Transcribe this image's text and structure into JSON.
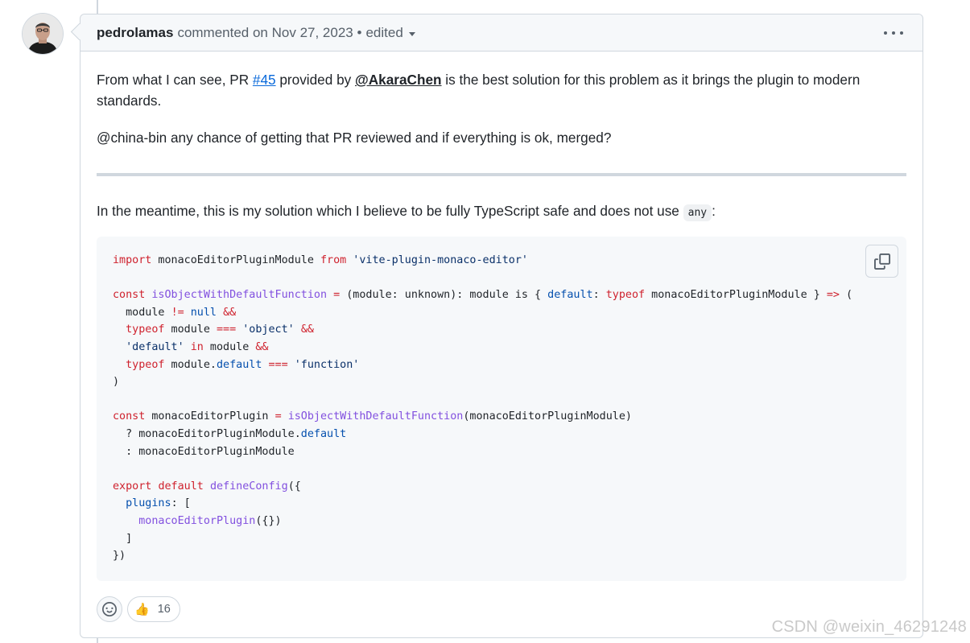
{
  "comment": {
    "author": "pedrolamas",
    "action": "commented on",
    "date": "Nov 27, 2023",
    "bullet": "•",
    "edited_label": "edited",
    "body": {
      "p1_pre": "From what I can see, PR ",
      "p1_link": "#45",
      "p1_mid": " provided by ",
      "p1_mention": "@AkaraChen",
      "p1_post": " is the best solution for this problem as it brings the plugin to modern standards.",
      "p2": "@china-bin any chance of getting that PR reviewed and if everything is ok, merged?",
      "p3_pre": "In the meantime, this is my solution which I believe to be fully TypeScript safe and does not use ",
      "p3_code": "any",
      "p3_post": ":"
    },
    "code_lines": [
      [
        {
          "t": "import",
          "c": "kw"
        },
        {
          "t": " monacoEditorPluginModule "
        },
        {
          "t": "from",
          "c": "kw"
        },
        {
          "t": " "
        },
        {
          "t": "'vite-plugin-monaco-editor'",
          "c": "st"
        }
      ],
      [],
      [
        {
          "t": "const",
          "c": "kw"
        },
        {
          "t": " "
        },
        {
          "t": "isObjectWithDefaultFunction",
          "c": "fn"
        },
        {
          "t": " "
        },
        {
          "t": "=",
          "c": "kw"
        },
        {
          "t": " (module: unknown): module is { "
        },
        {
          "t": "default",
          "c": "cn"
        },
        {
          "t": ": "
        },
        {
          "t": "typeof",
          "c": "kw"
        },
        {
          "t": " monacoEditorPluginModule } "
        },
        {
          "t": "=>",
          "c": "kw"
        },
        {
          "t": " ("
        }
      ],
      [
        {
          "t": "  module "
        },
        {
          "t": "!=",
          "c": "kw"
        },
        {
          "t": " "
        },
        {
          "t": "null",
          "c": "cn"
        },
        {
          "t": " "
        },
        {
          "t": "&&",
          "c": "kw"
        }
      ],
      [
        {
          "t": "  "
        },
        {
          "t": "typeof",
          "c": "kw"
        },
        {
          "t": " module "
        },
        {
          "t": "===",
          "c": "kw"
        },
        {
          "t": " "
        },
        {
          "t": "'object'",
          "c": "st"
        },
        {
          "t": " "
        },
        {
          "t": "&&",
          "c": "kw"
        }
      ],
      [
        {
          "t": "  "
        },
        {
          "t": "'default'",
          "c": "st"
        },
        {
          "t": " "
        },
        {
          "t": "in",
          "c": "kw"
        },
        {
          "t": " module "
        },
        {
          "t": "&&",
          "c": "kw"
        }
      ],
      [
        {
          "t": "  "
        },
        {
          "t": "typeof",
          "c": "kw"
        },
        {
          "t": " module."
        },
        {
          "t": "default",
          "c": "cn"
        },
        {
          "t": " "
        },
        {
          "t": "===",
          "c": "kw"
        },
        {
          "t": " "
        },
        {
          "t": "'function'",
          "c": "st"
        }
      ],
      [
        {
          "t": ")"
        }
      ],
      [],
      [
        {
          "t": "const",
          "c": "kw"
        },
        {
          "t": " monacoEditorPlugin "
        },
        {
          "t": "=",
          "c": "kw"
        },
        {
          "t": " "
        },
        {
          "t": "isObjectWithDefaultFunction",
          "c": "fn"
        },
        {
          "t": "(monacoEditorPluginModule)"
        }
      ],
      [
        {
          "t": "  ? monacoEditorPluginModule."
        },
        {
          "t": "default",
          "c": "cn"
        }
      ],
      [
        {
          "t": "  : monacoEditorPluginModule"
        }
      ],
      [],
      [
        {
          "t": "export",
          "c": "kw"
        },
        {
          "t": " "
        },
        {
          "t": "default",
          "c": "kw"
        },
        {
          "t": " "
        },
        {
          "t": "defineConfig",
          "c": "fn"
        },
        {
          "t": "({"
        }
      ],
      [
        {
          "t": "  "
        },
        {
          "t": "plugins",
          "c": "cn"
        },
        {
          "t": ": ["
        }
      ],
      [
        {
          "t": "    "
        },
        {
          "t": "monacoEditorPlugin",
          "c": "fn"
        },
        {
          "t": "({})"
        }
      ],
      [
        {
          "t": "  ]"
        }
      ],
      [
        {
          "t": "})"
        }
      ]
    ],
    "reactions": [
      {
        "emoji": "👍",
        "count": "16"
      }
    ],
    "icons": {
      "more": "kebab-horizontal-icon",
      "copy": "copy-icon",
      "add_reaction": "smiley-icon"
    }
  },
  "watermark": "CSDN @weixin_46291248",
  "colors": {
    "header_bg": "#f6f8fa",
    "border": "#d0d7de",
    "link": "#0969da",
    "keyword": "#cf222e",
    "function": "#8250df",
    "string": "#0a3069",
    "constant": "#0550ae"
  }
}
